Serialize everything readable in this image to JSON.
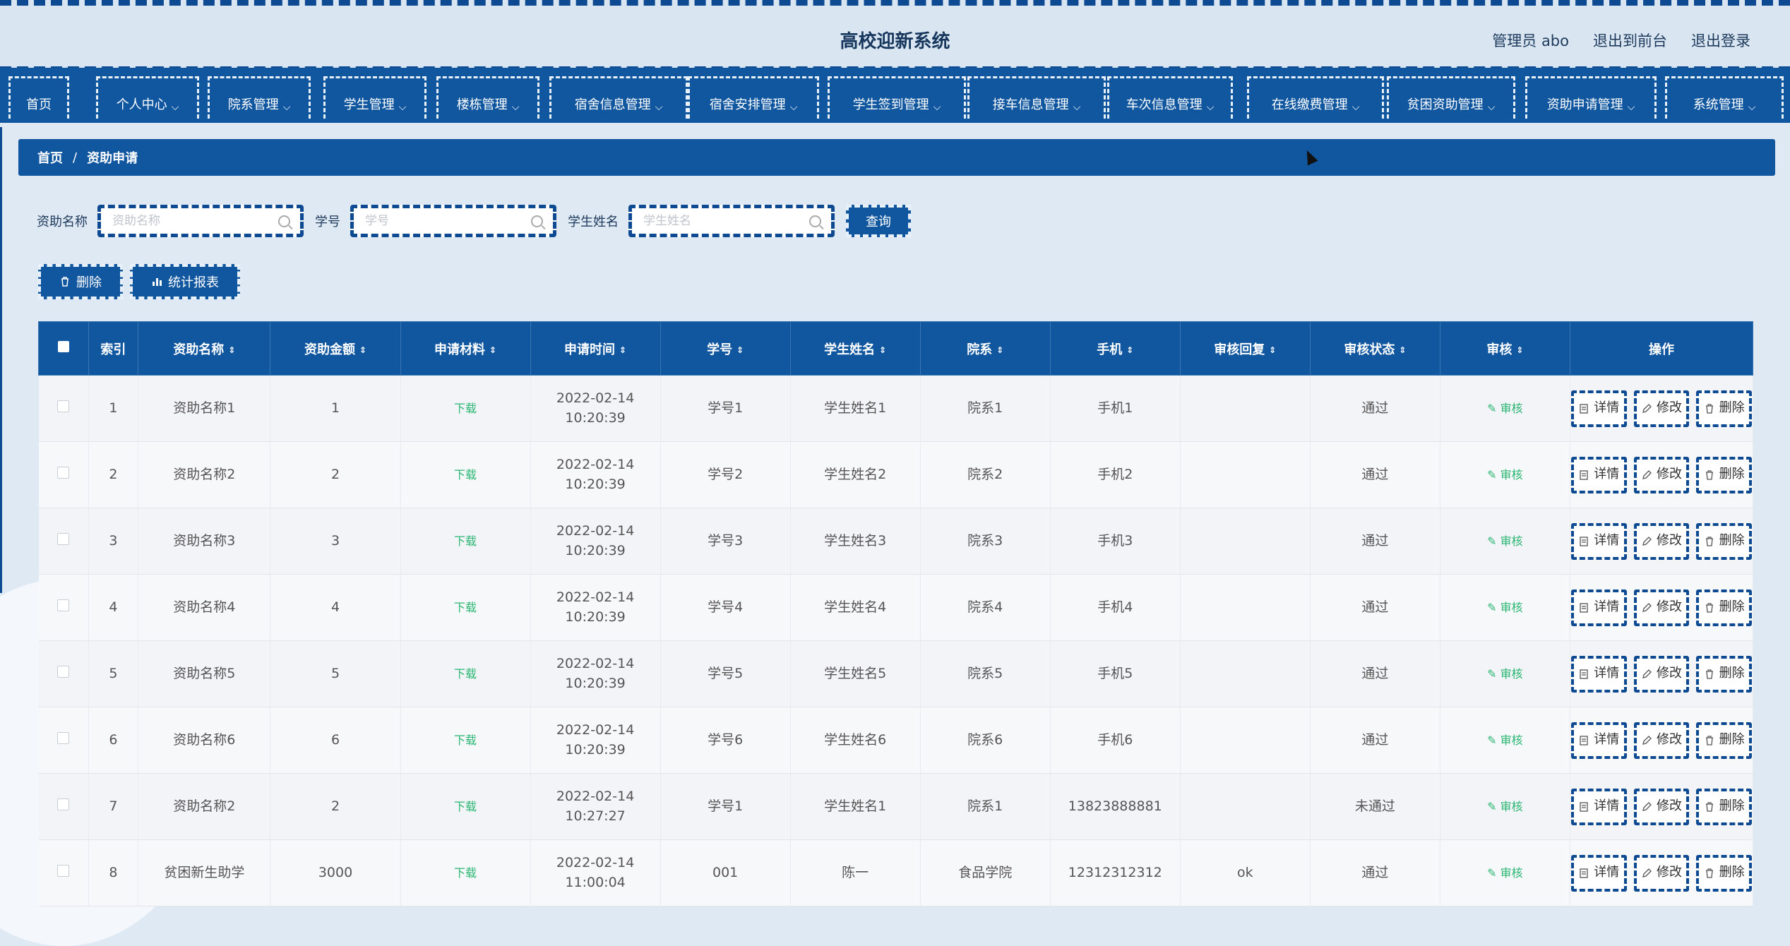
{
  "site": {
    "title": "高校迎新系统",
    "user": "管理员 abo",
    "exit_front": "退出到前台",
    "logout": "退出登录"
  },
  "nav": [
    {
      "label": "首页",
      "has_menu": false
    },
    {
      "label": "个人中心",
      "has_menu": true
    },
    {
      "label": "院系管理",
      "has_menu": true
    },
    {
      "label": "学生管理",
      "has_menu": true
    },
    {
      "label": "楼栋管理",
      "has_menu": true
    },
    {
      "label": "宿舍信息管理",
      "has_menu": true
    },
    {
      "label": "宿舍安排管理",
      "has_menu": true
    },
    {
      "label": "学生签到管理",
      "has_menu": true
    },
    {
      "label": "接车信息管理",
      "has_menu": true
    },
    {
      "label": "车次信息管理",
      "has_menu": true
    },
    {
      "label": "在线缴费管理",
      "has_menu": true
    },
    {
      "label": "贫困资助管理",
      "has_menu": true
    },
    {
      "label": "资助申请管理",
      "has_menu": true
    },
    {
      "label": "系统管理",
      "has_menu": true
    }
  ],
  "breadcrumb": {
    "home": "首页",
    "sep": "/",
    "current": "资助申请"
  },
  "search": {
    "f1_label": "资助名称",
    "f1_placeholder": "资助名称",
    "f2_label": "学号",
    "f2_placeholder": "学号",
    "f3_label": "学生姓名",
    "f3_placeholder": "学生姓名",
    "query": "查询"
  },
  "actions": {
    "delete": "删除",
    "report": "统计报表"
  },
  "table": {
    "headers": [
      "索引",
      "资助名称",
      "资助金额",
      "申请材料",
      "申请时间",
      "学号",
      "学生姓名",
      "院系",
      "手机",
      "审核回复",
      "审核状态",
      "审核",
      "操作"
    ],
    "download": "下载",
    "audit": "审核",
    "op_detail": "详情",
    "op_edit": "修改",
    "op_delete": "删除",
    "rows": [
      [
        "1",
        "资助名称1",
        "1",
        "2022-02-14 10:20:39",
        "学号1",
        "学生姓名1",
        "院系1",
        "手机1",
        "",
        "通过"
      ],
      [
        "2",
        "资助名称2",
        "2",
        "2022-02-14 10:20:39",
        "学号2",
        "学生姓名2",
        "院系2",
        "手机2",
        "",
        "通过"
      ],
      [
        "3",
        "资助名称3",
        "3",
        "2022-02-14 10:20:39",
        "学号3",
        "学生姓名3",
        "院系3",
        "手机3",
        "",
        "通过"
      ],
      [
        "4",
        "资助名称4",
        "4",
        "2022-02-14 10:20:39",
        "学号4",
        "学生姓名4",
        "院系4",
        "手机4",
        "",
        "通过"
      ],
      [
        "5",
        "资助名称5",
        "5",
        "2022-02-14 10:20:39",
        "学号5",
        "学生姓名5",
        "院系5",
        "手机5",
        "",
        "通过"
      ],
      [
        "6",
        "资助名称6",
        "6",
        "2022-02-14 10:20:39",
        "学号6",
        "学生姓名6",
        "院系6",
        "手机6",
        "",
        "通过"
      ],
      [
        "7",
        "资助名称2",
        "2",
        "2022-02-14 10:27:27",
        "学号1",
        "学生姓名1",
        "院系1",
        "13823888881",
        "",
        "未通过"
      ],
      [
        "8",
        "贫困新生助学",
        "3000",
        "2022-02-14 11:00:04",
        "001",
        "陈一",
        "食品学院",
        "12312312312",
        "ok",
        "通过"
      ]
    ]
  }
}
